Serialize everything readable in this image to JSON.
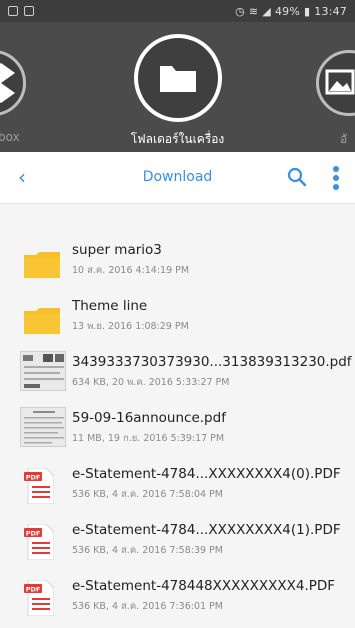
{
  "status": {
    "battery": "49%",
    "time": "13:47"
  },
  "header": {
    "left_label": "box",
    "main_label": "โฟลเดอร์ในเครื่อง",
    "right_label": "อั"
  },
  "toolbar": {
    "back": "‹",
    "title": "Download"
  },
  "files": [
    {
      "icon": "folder-icon",
      "name": "super mario3",
      "meta": "10 ส.ค. 2016 4:14:19 PM"
    },
    {
      "icon": "folder-icon",
      "name": "Theme line",
      "meta": "13 พ.ย. 2016 1:08:29 PM"
    },
    {
      "icon": "image-thumbnail-icon",
      "name": "3439333730373930...313839313230.pdf",
      "meta": "634 KB, 20 พ.ค. 2016 5:33:27 PM"
    },
    {
      "icon": "image-thumbnail-icon",
      "name": "59-09-16announce.pdf",
      "meta": "11 MB, 19 ก.ย. 2016 5:39:17 PM"
    },
    {
      "icon": "pdf-icon",
      "name": "e-Statement-4784...XXXXXXXX4(0).PDF",
      "meta": "536 KB, 4 ส.ค. 2016 7:58:04 PM"
    },
    {
      "icon": "pdf-icon",
      "name": "e-Statement-4784...XXXXXXXX4(1).PDF",
      "meta": "536 KB, 4 ส.ค. 2016 7:58:39 PM"
    },
    {
      "icon": "pdf-icon",
      "name": "e-Statement-478448XXXXXXXXX4.PDF",
      "meta": "536 KB, 4 ส.ค. 2016 7:36:01 PM"
    }
  ],
  "colors": {
    "accent": "#3a8ee6",
    "folder": "#f6c028",
    "pdf": "#e53935"
  }
}
